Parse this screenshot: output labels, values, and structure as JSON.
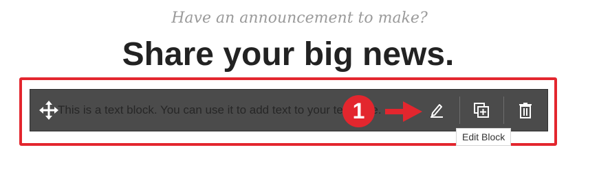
{
  "header": {
    "subhead": "Have an announcement to make?",
    "headline": "Share your big news."
  },
  "block": {
    "text": "This is a text block. You can use it to add text to your template.",
    "toolbar_bg": "#4b4b4b"
  },
  "toolbar": {
    "move_icon": "move-arrows-icon",
    "edit_icon": "pencil-icon",
    "duplicate_icon": "duplicate-icon",
    "delete_icon": "trash-icon"
  },
  "annotation": {
    "step_number": "1",
    "highlight_color": "#e3262e"
  },
  "tooltip": {
    "label": "Edit Block"
  }
}
